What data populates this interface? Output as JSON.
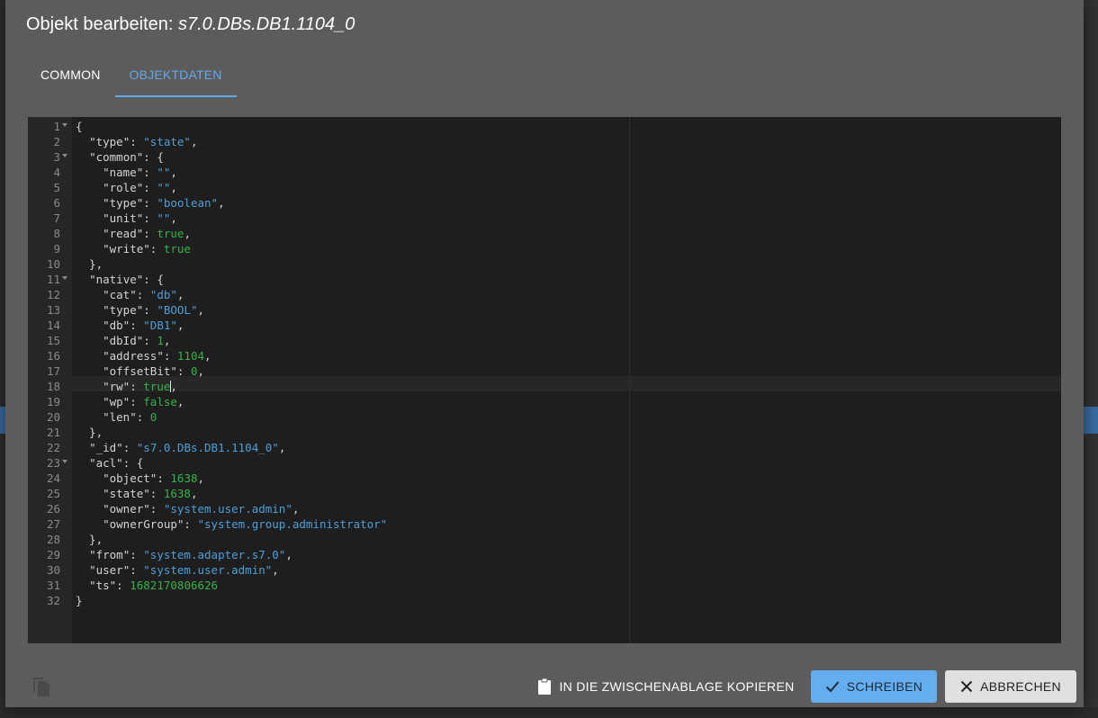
{
  "dialog": {
    "title_prefix": "Objekt bearbeiten: ",
    "title_object": "s7.0.DBs.DB1.1104_0"
  },
  "tabs": [
    {
      "label": "COMMON",
      "active": false
    },
    {
      "label": "OBJEKTDATEN",
      "active": true
    }
  ],
  "editor": {
    "active_line": 18,
    "fold_lines": [
      1,
      3,
      11,
      23
    ],
    "lines": [
      [
        [
          "p",
          "{"
        ]
      ],
      [
        [
          "p",
          "  "
        ],
        [
          "k",
          "\"type\""
        ],
        [
          "p",
          ": "
        ],
        [
          "s",
          "\"state\""
        ],
        [
          "p",
          ","
        ]
      ],
      [
        [
          "p",
          "  "
        ],
        [
          "k",
          "\"common\""
        ],
        [
          "p",
          ": {"
        ]
      ],
      [
        [
          "p",
          "    "
        ],
        [
          "k",
          "\"name\""
        ],
        [
          "p",
          ": "
        ],
        [
          "s",
          "\"\""
        ],
        [
          "p",
          ","
        ]
      ],
      [
        [
          "p",
          "    "
        ],
        [
          "k",
          "\"role\""
        ],
        [
          "p",
          ": "
        ],
        [
          "s",
          "\"\""
        ],
        [
          "p",
          ","
        ]
      ],
      [
        [
          "p",
          "    "
        ],
        [
          "k",
          "\"type\""
        ],
        [
          "p",
          ": "
        ],
        [
          "s",
          "\"boolean\""
        ],
        [
          "p",
          ","
        ]
      ],
      [
        [
          "p",
          "    "
        ],
        [
          "k",
          "\"unit\""
        ],
        [
          "p",
          ": "
        ],
        [
          "s",
          "\"\""
        ],
        [
          "p",
          ","
        ]
      ],
      [
        [
          "p",
          "    "
        ],
        [
          "k",
          "\"read\""
        ],
        [
          "p",
          ": "
        ],
        [
          "b",
          "true"
        ],
        [
          "p",
          ","
        ]
      ],
      [
        [
          "p",
          "    "
        ],
        [
          "k",
          "\"write\""
        ],
        [
          "p",
          ": "
        ],
        [
          "b",
          "true"
        ]
      ],
      [
        [
          "p",
          "  },"
        ]
      ],
      [
        [
          "p",
          "  "
        ],
        [
          "k",
          "\"native\""
        ],
        [
          "p",
          ": {"
        ]
      ],
      [
        [
          "p",
          "    "
        ],
        [
          "k",
          "\"cat\""
        ],
        [
          "p",
          ": "
        ],
        [
          "s",
          "\"db\""
        ],
        [
          "p",
          ","
        ]
      ],
      [
        [
          "p",
          "    "
        ],
        [
          "k",
          "\"type\""
        ],
        [
          "p",
          ": "
        ],
        [
          "s",
          "\"BOOL\""
        ],
        [
          "p",
          ","
        ]
      ],
      [
        [
          "p",
          "    "
        ],
        [
          "k",
          "\"db\""
        ],
        [
          "p",
          ": "
        ],
        [
          "s",
          "\"DB1\""
        ],
        [
          "p",
          ","
        ]
      ],
      [
        [
          "p",
          "    "
        ],
        [
          "k",
          "\"dbId\""
        ],
        [
          "p",
          ": "
        ],
        [
          "n",
          "1"
        ],
        [
          "p",
          ","
        ]
      ],
      [
        [
          "p",
          "    "
        ],
        [
          "k",
          "\"address\""
        ],
        [
          "p",
          ": "
        ],
        [
          "n",
          "1104"
        ],
        [
          "p",
          ","
        ]
      ],
      [
        [
          "p",
          "    "
        ],
        [
          "k",
          "\"offsetBit\""
        ],
        [
          "p",
          ": "
        ],
        [
          "n",
          "0"
        ],
        [
          "p",
          ","
        ]
      ],
      [
        [
          "p",
          "    "
        ],
        [
          "k",
          "\"rw\""
        ],
        [
          "p",
          ": "
        ],
        [
          "b",
          "true"
        ],
        [
          "p",
          ","
        ]
      ],
      [
        [
          "p",
          "    "
        ],
        [
          "k",
          "\"wp\""
        ],
        [
          "p",
          ": "
        ],
        [
          "b",
          "false"
        ],
        [
          "p",
          ","
        ]
      ],
      [
        [
          "p",
          "    "
        ],
        [
          "k",
          "\"len\""
        ],
        [
          "p",
          ": "
        ],
        [
          "n",
          "0"
        ]
      ],
      [
        [
          "p",
          "  },"
        ]
      ],
      [
        [
          "p",
          "  "
        ],
        [
          "k",
          "\"_id\""
        ],
        [
          "p",
          ": "
        ],
        [
          "s",
          "\"s7.0.DBs.DB1.1104_0\""
        ],
        [
          "p",
          ","
        ]
      ],
      [
        [
          "p",
          "  "
        ],
        [
          "k",
          "\"acl\""
        ],
        [
          "p",
          ": {"
        ]
      ],
      [
        [
          "p",
          "    "
        ],
        [
          "k",
          "\"object\""
        ],
        [
          "p",
          ": "
        ],
        [
          "n",
          "1638"
        ],
        [
          "p",
          ","
        ]
      ],
      [
        [
          "p",
          "    "
        ],
        [
          "k",
          "\"state\""
        ],
        [
          "p",
          ": "
        ],
        [
          "n",
          "1638"
        ],
        [
          "p",
          ","
        ]
      ],
      [
        [
          "p",
          "    "
        ],
        [
          "k",
          "\"owner\""
        ],
        [
          "p",
          ": "
        ],
        [
          "s",
          "\"system.user.admin\""
        ],
        [
          "p",
          ","
        ]
      ],
      [
        [
          "p",
          "    "
        ],
        [
          "k",
          "\"ownerGroup\""
        ],
        [
          "p",
          ": "
        ],
        [
          "s",
          "\"system.group.administrator\""
        ]
      ],
      [
        [
          "p",
          "  },"
        ]
      ],
      [
        [
          "p",
          "  "
        ],
        [
          "k",
          "\"from\""
        ],
        [
          "p",
          ": "
        ],
        [
          "s",
          "\"system.adapter.s7.0\""
        ],
        [
          "p",
          ","
        ]
      ],
      [
        [
          "p",
          "  "
        ],
        [
          "k",
          "\"user\""
        ],
        [
          "p",
          ": "
        ],
        [
          "s",
          "\"system.user.admin\""
        ],
        [
          "p",
          ","
        ]
      ],
      [
        [
          "p",
          "  "
        ],
        [
          "k",
          "\"ts\""
        ],
        [
          "p",
          ": "
        ],
        [
          "n",
          "1682170806626"
        ]
      ],
      [
        [
          "p",
          "}"
        ]
      ]
    ]
  },
  "footer": {
    "copy_icon": "file-copy-icon",
    "clipboard_label": "IN DIE ZWISCHENABLAGE KOPIEREN",
    "clipboard_icon": "clipboard-icon",
    "write_label": "SCHREIBEN",
    "write_icon": "check-icon",
    "cancel_label": "ABBRECHEN",
    "cancel_icon": "close-icon"
  },
  "colors": {
    "dialog_bg": "#5c5c5c",
    "accent": "#64a8e8",
    "string": "#4f9fd8",
    "number": "#36b24a",
    "editor_bg": "#1e1e1e"
  }
}
